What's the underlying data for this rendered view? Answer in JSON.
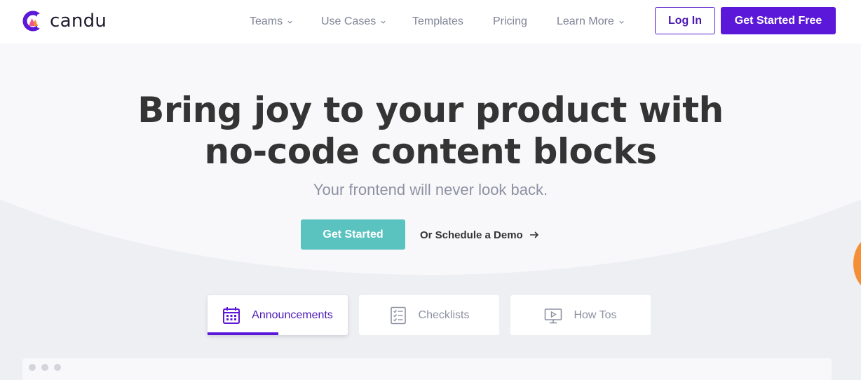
{
  "brand": {
    "name": "candu",
    "colors": {
      "primary": "#5c18d8",
      "accent": "#5ac3bf",
      "orange": "#f58f35"
    }
  },
  "nav": {
    "items": [
      {
        "label": "Teams",
        "dropdown": true
      },
      {
        "label": "Use Cases",
        "dropdown": true
      },
      {
        "label": "Templates",
        "dropdown": false
      },
      {
        "label": "Pricing",
        "dropdown": false
      },
      {
        "label": "Learn More",
        "dropdown": true
      }
    ],
    "login_label": "Log In",
    "cta_label": "Get Started Free"
  },
  "hero": {
    "title_line1": "Bring joy to your product with",
    "title_line2": "no-code content blocks",
    "subtitle": "Your frontend will never look back.",
    "primary_cta": "Get Started",
    "secondary_cta": "Or Schedule a Demo"
  },
  "tabs": [
    {
      "label": "Announcements",
      "icon": "calendar-icon",
      "active": true
    },
    {
      "label": "Checklists",
      "icon": "checklist-icon",
      "active": false
    },
    {
      "label": "How Tos",
      "icon": "video-monitor-icon",
      "active": false
    }
  ]
}
